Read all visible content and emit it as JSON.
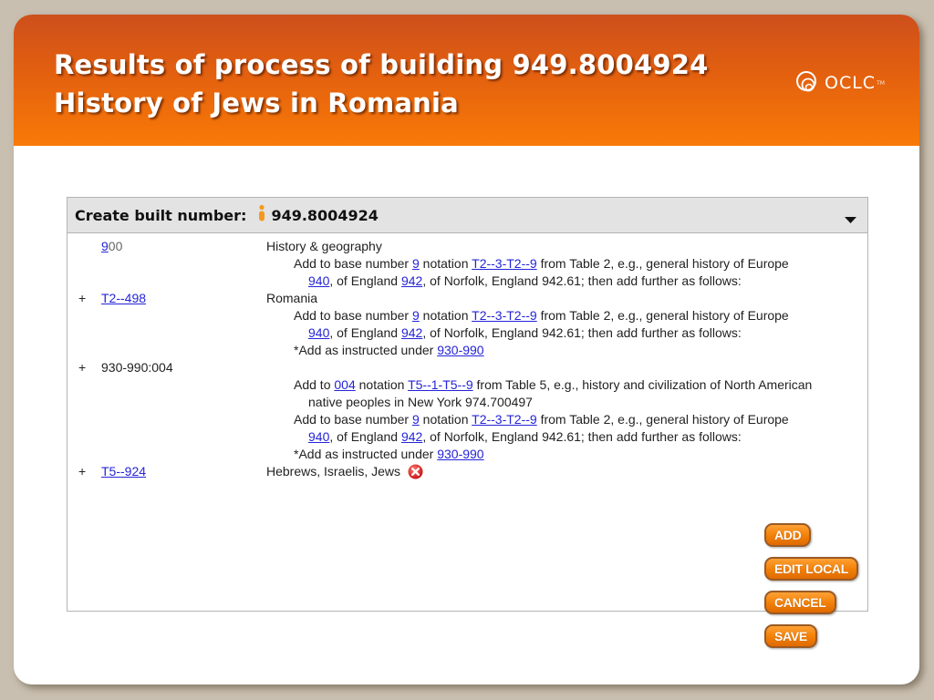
{
  "slide": {
    "title_line1": "Results of process of building 949.8004924",
    "title_line2": "History of Jews in Romania",
    "logo_text": "OCLC",
    "logo_tm": "TM",
    "colors": {
      "banner_top": "#cd4f1c",
      "banner_bottom": "#f97a07",
      "link": "#2424d8",
      "button": "#f17f07"
    }
  },
  "panel": {
    "header_label": "Create built number:",
    "built_number": "949.8004924",
    "dropdown_icon": "triangle-down-icon",
    "person_icon": "person-icon"
  },
  "rows": [
    {
      "plus": "",
      "code_link_part": "9",
      "code_rest": "00",
      "desc": "History & geography"
    },
    {
      "note_a": "Add to base number ",
      "link_a": "9",
      "note_b": " notation ",
      "link_b": "T2--3-T2--9",
      "note_c": " from Table 2, e.g., general history of Europe"
    },
    {
      "link_a": "940",
      "note_a": ", of England ",
      "link_b": "942",
      "note_b": ", of Norfolk, England 942.61; then add further as follows:"
    },
    {
      "plus": "+",
      "code": "T2--498",
      "desc": "Romania"
    },
    {
      "note_a": "Add to base number ",
      "link_a": "9",
      "note_b": " notation ",
      "link_b": "T2--3-T2--9",
      "note_c": " from Table 2, e.g., general history of Europe"
    },
    {
      "link_a": "940",
      "note_a": ", of England ",
      "link_b": "942",
      "note_b": ", of Norfolk, England 942.61; then add further as follows:"
    },
    {
      "note_a": "*Add as instructed under ",
      "link_a": "930-990"
    },
    {
      "plus": "+",
      "code": "930-990:004"
    },
    {
      "note_a": "Add to ",
      "link_a": "004",
      "note_b": " notation ",
      "link_b": "T5--1-T5--9",
      "note_c": " from Table 5, e.g., history and civilization of North American"
    },
    {
      "note_a": "native peoples in New York 974.700497"
    },
    {
      "note_a": "Add to base number ",
      "link_a": "9",
      "note_b": " notation ",
      "link_b": "T2--3-T2--9",
      "note_c": " from Table 2, e.g., general history of Europe"
    },
    {
      "link_a": "940",
      "note_a": ", of England ",
      "link_b": "942",
      "note_b": ", of Norfolk, England 942.61; then add further as follows:"
    },
    {
      "note_a": "*Add as instructed under ",
      "link_a": "930-990"
    },
    {
      "plus": "+",
      "code": "T5--924",
      "desc": "Hebrews, Israelis, Jews",
      "remove_icon": "remove-x-icon"
    }
  ],
  "buttons": {
    "add": "ADD",
    "edit_local": "EDIT LOCAL",
    "cancel": "CANCEL",
    "save": "SAVE"
  }
}
